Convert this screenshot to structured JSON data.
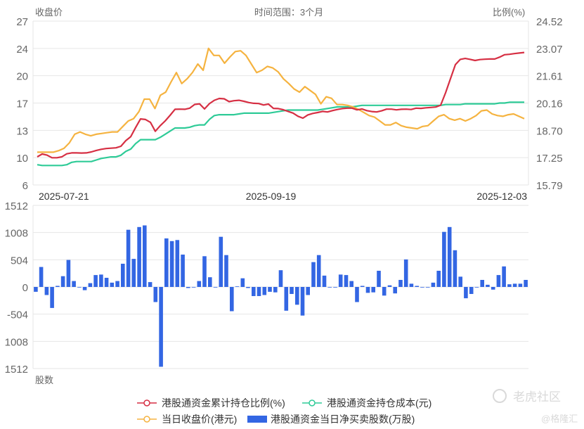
{
  "colors": {
    "ratio": "#d62f43",
    "cost": "#2ecb97",
    "price": "#f5b340",
    "netbuy": "#3366e3",
    "grid": "#e6e6e6",
    "axis_text": "#666666"
  },
  "header": {
    "left_label": "收盘价",
    "center_label": "时间范围：3个月",
    "right_label": "比例(%)"
  },
  "bottom_axis_label": "股数",
  "watermark": {
    "logo": "老虎社区",
    "sub": "@格隆汇"
  },
  "legend": [
    {
      "label": "港股通资金累计持仓比例(%)",
      "icon": "line-circle",
      "color_key": "ratio"
    },
    {
      "label": "港股通资金持仓成本(元)",
      "icon": "line-circle",
      "color_key": "cost"
    },
    {
      "label": "当日收盘价(港元)",
      "icon": "line-circle",
      "color_key": "price"
    },
    {
      "label": "港股通资金当日净买卖股数(万股)",
      "icon": "bar",
      "color_key": "netbuy"
    }
  ],
  "chart_data": [
    {
      "type": "line",
      "title": "",
      "x_ticks": [
        "2025-07-21",
        "2025-09-19",
        "2025-12-03"
      ],
      "y_left": {
        "label": "收盘价",
        "ticks": [
          "6",
          "10",
          "13",
          "17",
          "20",
          "24",
          "27"
        ],
        "range": [
          6,
          27
        ]
      },
      "y_right": {
        "label": "比例(%)",
        "ticks": [
          "15.79",
          "17.25",
          "18.70",
          "20.16",
          "21.61",
          "23.07",
          "24.52"
        ],
        "range": [
          15.79,
          24.52
        ]
      },
      "series": [
        {
          "name": "港股通资金累计持仓比例(%)",
          "axis": "right",
          "color_key": "ratio",
          "values": [
            17.29,
            17.44,
            17.38,
            17.24,
            17.24,
            17.29,
            17.45,
            17.5,
            17.5,
            17.49,
            17.5,
            17.55,
            17.63,
            17.69,
            17.73,
            17.75,
            17.77,
            17.85,
            18.15,
            18.36,
            18.85,
            19.31,
            19.28,
            19.13,
            18.65,
            18.95,
            19.2,
            19.5,
            19.82,
            19.83,
            19.82,
            19.88,
            20.08,
            20.11,
            19.84,
            20.12,
            20.3,
            20.4,
            20.38,
            20.23,
            20.28,
            20.3,
            20.25,
            20.18,
            20.14,
            20.13,
            20.05,
            20.1,
            19.87,
            19.86,
            19.8,
            19.71,
            19.62,
            19.45,
            19.35,
            19.52,
            19.6,
            19.65,
            19.71,
            19.68,
            19.75,
            19.81,
            19.86,
            19.88,
            19.88,
            19.79,
            19.84,
            19.75,
            19.7,
            19.68,
            19.74,
            19.83,
            19.83,
            19.79,
            19.82,
            19.83,
            19.81,
            19.88,
            19.87,
            19.9,
            19.92,
            19.94,
            20.04,
            20.7,
            21.45,
            22.2,
            22.48,
            22.53,
            22.48,
            22.42,
            22.47,
            22.49,
            22.5,
            22.5,
            22.6,
            22.73,
            22.75,
            22.79,
            22.82,
            22.85
          ]
        },
        {
          "name": "港股通资金持仓成本(元)",
          "axis": "left",
          "color_key": "cost",
          "values": [
            8.6,
            8.5,
            8.5,
            8.5,
            8.5,
            8.5,
            8.6,
            8.9,
            9.0,
            9.0,
            9.0,
            9.0,
            9.2,
            9.4,
            9.5,
            9.6,
            9.6,
            9.8,
            10.3,
            10.6,
            11.3,
            11.8,
            11.8,
            11.8,
            11.8,
            12.1,
            12.5,
            12.9,
            13.3,
            13.3,
            13.3,
            13.4,
            13.6,
            13.7,
            13.7,
            14.4,
            14.9,
            15.0,
            15.0,
            15.0,
            15.0,
            15.1,
            15.2,
            15.2,
            15.2,
            15.2,
            15.2,
            15.2,
            15.3,
            15.4,
            15.5,
            15.6,
            15.6,
            15.6,
            15.6,
            15.6,
            15.6,
            15.6,
            15.7,
            15.8,
            15.9,
            16.0,
            16.0,
            16.0,
            16.0,
            16.1,
            16.2,
            16.2,
            16.2,
            16.2,
            16.2,
            16.2,
            16.2,
            16.2,
            16.2,
            16.2,
            16.2,
            16.2,
            16.2,
            16.2,
            16.2,
            16.2,
            16.2,
            16.3,
            16.3,
            16.3,
            16.3,
            16.4,
            16.4,
            16.4,
            16.4,
            16.4,
            16.4,
            16.4,
            16.5,
            16.5,
            16.6,
            16.6,
            16.6,
            16.6
          ]
        },
        {
          "name": "当日收盘价(港元)",
          "axis": "left",
          "color_key": "price",
          "values": [
            10.2,
            10.2,
            10.2,
            10.2,
            10.4,
            10.7,
            11.4,
            12.5,
            12.8,
            12.5,
            12.3,
            12.5,
            12.6,
            12.7,
            12.8,
            12.8,
            13.5,
            14.2,
            14.5,
            15.4,
            17.0,
            17.0,
            15.8,
            17.5,
            17.9,
            19.2,
            20.4,
            19.0,
            19.6,
            20.4,
            21.5,
            20.7,
            23.5,
            22.6,
            22.6,
            21.6,
            22.4,
            23.1,
            23.2,
            22.6,
            21.5,
            20.4,
            20.7,
            21.2,
            21.0,
            20.5,
            19.6,
            19.0,
            18.3,
            17.9,
            18.6,
            18.1,
            17.6,
            16.4,
            17.3,
            17.1,
            16.3,
            16.3,
            16.2,
            16.0,
            15.7,
            15.3,
            14.9,
            14.7,
            14.2,
            13.7,
            13.7,
            14.0,
            13.6,
            13.4,
            13.3,
            13.2,
            13.5,
            13.6,
            14.2,
            14.8,
            15.0,
            14.5,
            14.3,
            14.5,
            14.2,
            14.5,
            14.9,
            15.5,
            15.6,
            15.1,
            14.9,
            14.8,
            15.0,
            15.1,
            14.8,
            14.5
          ]
        }
      ]
    },
    {
      "type": "bar",
      "title": "",
      "y": {
        "label": "股数",
        "ticks": [
          "1512",
          "1008",
          "504",
          "0",
          "-504",
          "1008",
          "1512"
        ],
        "range": [
          -1512,
          1512
        ]
      },
      "series": [
        {
          "name": "港股通资金当日净买卖股数(万股)",
          "color_key": "netbuy",
          "values": [
            -90,
            370,
            -150,
            -390,
            20,
            200,
            500,
            110,
            -10,
            -60,
            70,
            220,
            230,
            170,
            80,
            110,
            430,
            1060,
            520,
            1110,
            1140,
            90,
            -280,
            -1480,
            900,
            850,
            870,
            600,
            -20,
            -10,
            110,
            570,
            180,
            -10,
            930,
            590,
            -450,
            10,
            160,
            -20,
            -170,
            -170,
            -150,
            -90,
            -100,
            310,
            -440,
            -130,
            -330,
            -530,
            -150,
            460,
            590,
            210,
            -10,
            -10,
            230,
            220,
            110,
            -280,
            20,
            -110,
            -100,
            300,
            -160,
            30,
            -120,
            130,
            510,
            60,
            20,
            -10,
            -10,
            80,
            300,
            1020,
            1110,
            680,
            190,
            -210,
            -130,
            -10,
            130,
            40,
            -50,
            220,
            380,
            50,
            60,
            60,
            130
          ]
        }
      ]
    }
  ]
}
